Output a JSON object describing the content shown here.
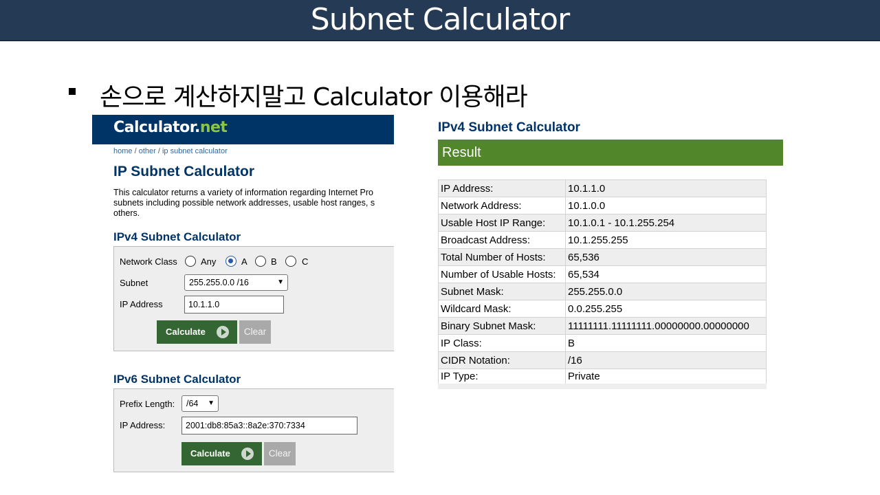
{
  "slide": {
    "title": "Subnet Calculator",
    "bullet": "손으로 계산하지말고 Calculator 이용해라"
  },
  "site": {
    "logo_main": "Calculator",
    "logo_dot": ".",
    "logo_tld": "net",
    "banner_color": "#003366",
    "breadcrumb": {
      "home": "home",
      "sep1": " / ",
      "other": "other",
      "sep2": " / ",
      "current": "ip subnet calculator"
    },
    "page_title": "IP Subnet Calculator",
    "intro_lines": [
      "This calculator returns a variety of information regarding Internet Pro",
      "subnets including possible network addresses, usable host ranges, s",
      "others."
    ]
  },
  "ipv4": {
    "heading": "IPv4 Subnet Calculator",
    "network_class_label": "Network Class",
    "class_options": [
      "Any",
      "A",
      "B",
      "C"
    ],
    "selected_class": "A",
    "subnet_label": "Subnet",
    "subnet_value": "255.255.0.0 /16",
    "ip_label": "IP Address",
    "ip_value": "10.1.1.0",
    "calculate_label": "Calculate",
    "clear_label": "Clear"
  },
  "ipv6": {
    "heading": "IPv6 Subnet Calculator",
    "prefix_label": "Prefix Length:",
    "prefix_value": "/64",
    "ip_label": "IP Address:",
    "ip_value": "2001:db8:85a3::8a2e:370:7334",
    "calculate_label": "Calculate",
    "clear_label": "Clear"
  },
  "result": {
    "heading": "IPv4 Subnet Calculator",
    "bar_label": "Result",
    "bar_color": "#51862a",
    "rows": [
      {
        "key": "IP Address:",
        "value": "10.1.1.0"
      },
      {
        "key": "Network Address:",
        "value": "10.1.0.0"
      },
      {
        "key": "Usable Host IP Range:",
        "value": "10.1.0.1 - 10.1.255.254"
      },
      {
        "key": "Broadcast Address:",
        "value": "10.1.255.255"
      },
      {
        "key": "Total Number of Hosts:",
        "value": "65,536"
      },
      {
        "key": "Number of Usable Hosts:",
        "value": "65,534"
      },
      {
        "key": "Subnet Mask:",
        "value": "255.255.0.0"
      },
      {
        "key": "Wildcard Mask:",
        "value": "0.0.255.255"
      },
      {
        "key": "Binary Subnet Mask:",
        "value": "11111111.11111111.00000000.00000000"
      },
      {
        "key": "IP Class:",
        "value": "B"
      },
      {
        "key": "CIDR Notation:",
        "value": "/16"
      },
      {
        "key": "IP Type:",
        "value": "Private"
      }
    ]
  }
}
